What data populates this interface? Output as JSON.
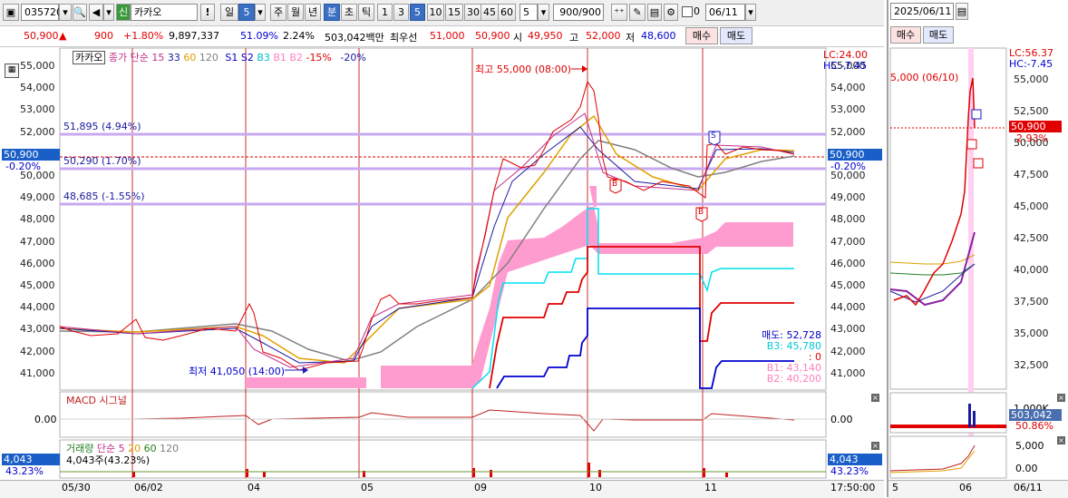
{
  "toolbar": {
    "code": "035720",
    "name_badge": "신",
    "name": "카카오",
    "excl": "!",
    "period_day": "일",
    "period_num": "5",
    "periods": [
      "주",
      "월",
      "년",
      "분",
      "초",
      "틱"
    ],
    "minutes": [
      "1",
      "3",
      "5",
      "10",
      "15",
      "30",
      "45",
      "60"
    ],
    "interval_value": "5",
    "count_value": "900/900",
    "checkbox_label": "0",
    "date_value": "06/11"
  },
  "quote": {
    "price": "50,900",
    "arrow": "▲",
    "change": "900",
    "change_pct": "+1.80%",
    "volume": "9,897,337",
    "vol_ratio": "51.09%",
    "turnover": "2.24%",
    "amount": "503,042백만",
    "best_label": "최우선",
    "ask": "51,000",
    "bid": "50,900",
    "open_label": "시",
    "open": "49,950",
    "high_label": "고",
    "high": "52,000",
    "low_label": "저",
    "low": "48,600",
    "buy_btn": "매수",
    "sell_btn": "매도"
  },
  "main_chart": {
    "legend": {
      "name": "카카오",
      "ma_label": "종가 단순",
      "ma_periods": [
        "15",
        "33",
        "60",
        "120"
      ],
      "signals": [
        "S1",
        "S2",
        "B3",
        "B1",
        "B2"
      ],
      "pcts": [
        "-15%",
        "-20%"
      ]
    },
    "lc": "LC:24.00",
    "hc": "HC:-7.45",
    "y_ticks": [
      "55,000",
      "54,000",
      "53,000",
      "52,000",
      "51,000",
      "50,000",
      "49,000",
      "48,000",
      "47,000",
      "46,000",
      "45,000",
      "44,000",
      "43,000",
      "42,000",
      "41,000"
    ],
    "price_badge": "50,900",
    "price_badge_pct": "-0.20%",
    "lines": [
      {
        "label": "51,895 (4.94%)",
        "value": 51895
      },
      {
        "label": "50,290 (1.70%)",
        "value": 50290
      },
      {
        "label": "48,685 (-1.55%)",
        "value": 48685
      }
    ],
    "max_label": "최고 55,000 (08:00)",
    "min_label": "최저 41,050 (14:00)",
    "levels": [
      {
        "label": "매도: 52,728",
        "color": "#0000c0"
      },
      {
        "label": "B3: 45,780",
        "color": "#00c8d8"
      },
      {
        "label": ": 0",
        "color": "#e00000"
      },
      {
        "label": "B1: 43,140",
        "color": "#ff80c0"
      },
      {
        "label": "B2: 40,200",
        "color": "#ff80c0"
      }
    ],
    "marker_b": "B",
    "marker_s": "S"
  },
  "macd": {
    "label1": "MACD",
    "label2": "시그널",
    "y_tick": "0.00",
    "right_tick": "0.00"
  },
  "volume": {
    "label": "거래량",
    "ma_label": "단순",
    "ma_periods": [
      "5",
      "20",
      "60",
      "120"
    ],
    "info": "4,043주(43.23%)",
    "badge": "4,043",
    "badge_pct": "43.23%",
    "right_badge": "4,043",
    "right_badge_pct": "43.23%"
  },
  "x_axis": [
    "05/30",
    "06/02",
    "04",
    "05",
    "09",
    "10",
    "11"
  ],
  "time_label": "17:50:00",
  "right_panel": {
    "date": "2025/06/11",
    "buy_btn": "매수",
    "sell_btn": "매도",
    "max_label": "5,000 (06/10)",
    "lc": "LC:56.37",
    "hc": "HC:-7.45",
    "y_ticks": [
      "55,000",
      "52,500",
      "50,000",
      "47,500",
      "45,000",
      "42,500",
      "40,000",
      "37,500",
      "35,000",
      "32,500"
    ],
    "price_badge": "50,900",
    "price_pct": "2.93%",
    "vol_labels": [
      "1,000K"
    ],
    "vol_badge": "503,042",
    "vol_pct": "50.86%",
    "ind_ticks": [
      "5,000",
      "0.00"
    ],
    "x_axis": [
      "5",
      "06",
      "06/11"
    ]
  },
  "colors": {
    "up": "#e00000",
    "down": "#0000d0",
    "pink": "#ff9ccf",
    "lavender": "#c8a8f0",
    "badge": "#1a5fc8"
  }
}
